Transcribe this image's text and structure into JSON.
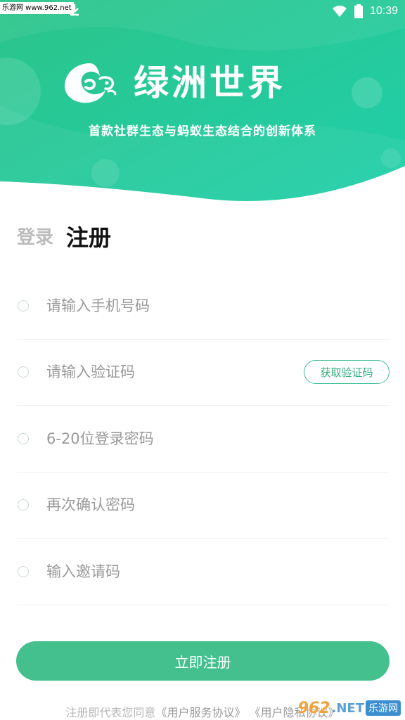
{
  "status_bar": {
    "watermark": "乐游网 www.962.net",
    "time": "10:39",
    "icons": [
      "notification-icon",
      "notification-icon",
      "notification-icon",
      "download-icon",
      "wifi-icon",
      "battery-icon"
    ]
  },
  "header": {
    "logo": "oasis-logo-icon",
    "title": "绿洲世界",
    "slogan": "首款社群生态与蚂蚁生态结合的创新体系",
    "colors": {
      "gradient_start": "#2cc48a",
      "gradient_end": "#22cfa8"
    }
  },
  "tabs": {
    "login_label": "登录",
    "register_label": "注册",
    "active": "register"
  },
  "form": {
    "phone_placeholder": "请输入手机号码",
    "code_placeholder": "请输入验证码",
    "get_code_label": "获取验证码",
    "password_placeholder": "6-20位登录密码",
    "confirm_password_placeholder": "再次确认密码",
    "invite_placeholder": "输入邀请码"
  },
  "submit": {
    "label": "立即注册",
    "color": "#44c08e"
  },
  "agreement": {
    "prefix": "注册即代表您同意",
    "service_link": "《用户服务协议》",
    "privacy_link": "《用户隐私协议》"
  },
  "watermark_bottom": {
    "number": "962",
    "domain": ".NET",
    "site": "乐游网"
  }
}
